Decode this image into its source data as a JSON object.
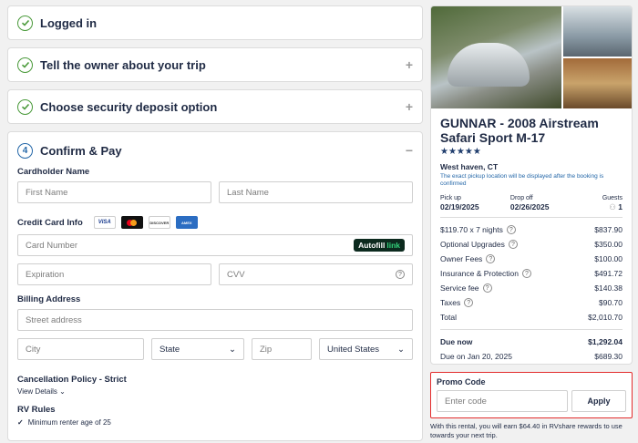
{
  "steps": [
    {
      "title": "Logged in"
    },
    {
      "title": "Tell the owner about your trip"
    },
    {
      "title": "Choose security deposit option"
    }
  ],
  "pay": {
    "number": "4",
    "title": "Confirm & Pay",
    "cardholder_label": "Cardholder Name",
    "first_name_placeholder": "First Name",
    "last_name_placeholder": "Last Name",
    "credit_label": "Credit Card Info",
    "card_brands": [
      "VISA",
      "mastercard",
      "DISCOVER",
      "AMERICAN EXPRESS"
    ],
    "card_number_placeholder": "Card Number",
    "autofill": "Autofill",
    "autofill_link": "link",
    "expiration_placeholder": "Expiration",
    "cvv_placeholder": "CVV",
    "billing_label": "Billing Address",
    "street_placeholder": "Street address",
    "city_placeholder": "City",
    "state_value": "State",
    "zip_placeholder": "Zip",
    "country_value": "United States",
    "policy_label": "Cancellation Policy - Strict",
    "view_details": "View Details",
    "rules_label": "RV Rules",
    "rule_1": "Minimum renter age of 25"
  },
  "listing": {
    "name": "GUNNAR - 2008 Airstream Safari Sport M-17",
    "stars": "★★★★★",
    "location": "West haven, CT",
    "pickup_note": "The exact pickup location will be displayed after the booking is confirmed",
    "pickup_label": "Pick up",
    "pickup_date": "02/19/2025",
    "dropoff_label": "Drop off",
    "dropoff_date": "02/26/2025",
    "guests_label": "Guests",
    "guests_value": "1",
    "prices": [
      {
        "label": "$119.70 x 7 nights",
        "value": "$837.90",
        "help": true
      },
      {
        "label": "Optional Upgrades",
        "value": "$350.00",
        "help": true
      },
      {
        "label": "Owner Fees",
        "value": "$100.00",
        "help": true
      },
      {
        "label": "Insurance & Protection",
        "value": "$491.72",
        "help": true
      },
      {
        "label": "Service fee",
        "value": "$140.38",
        "help": true
      },
      {
        "label": "Taxes",
        "value": "$90.70",
        "help": true
      },
      {
        "label": "Total",
        "value": "$2,010.70",
        "help": false
      }
    ],
    "due_now_label": "Due now",
    "due_now_value": "$1,292.04",
    "due_later_label": "Due on Jan 20, 2025",
    "due_later_value": "$689.30"
  },
  "promo": {
    "label": "Promo Code",
    "placeholder": "Enter code",
    "apply": "Apply",
    "rewards_text": "With this rental, you will earn $64.40 in RVshare rewards to use towards your next trip."
  },
  "colors": {
    "accent": "#2467a8",
    "check": "#4a9a3a",
    "highlight": "#e32c2c"
  }
}
